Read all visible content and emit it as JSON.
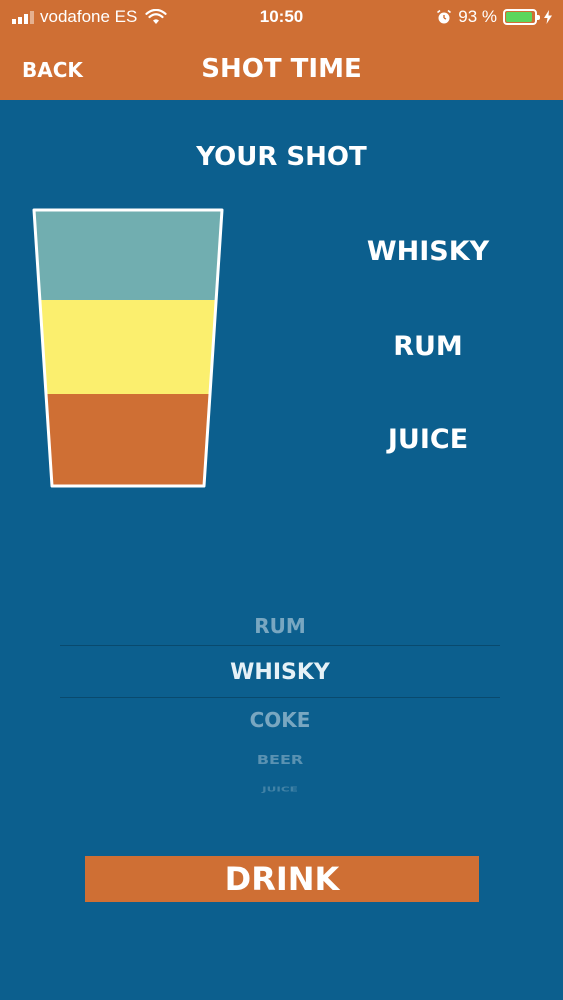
{
  "status": {
    "carrier": "vodafone ES",
    "time": "10:50",
    "battery_percent": "93 %",
    "battery_level": 0.93
  },
  "nav": {
    "back_label": "BACK",
    "title": "SHOT TIME"
  },
  "heading": "YOUR SHOT",
  "layers": [
    {
      "name": "WHISKY",
      "color": "#71aeb0"
    },
    {
      "name": "RUM",
      "color": "#fbef6e"
    },
    {
      "name": "JUICE",
      "color": "#cf6f34"
    }
  ],
  "picker": {
    "options": [
      "RUM",
      "WHISKY",
      "COKE",
      "BEER",
      "JUICE"
    ],
    "selected": "WHISKY"
  },
  "drink_button": "DRINK"
}
